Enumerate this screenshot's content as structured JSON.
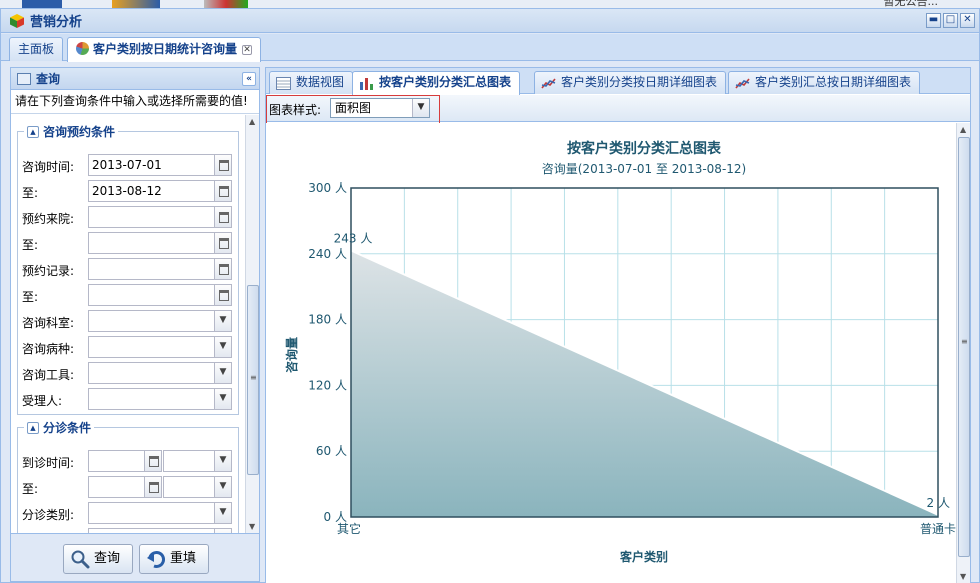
{
  "top_strip": {
    "notice": "暂无公告..."
  },
  "window": {
    "title": "营销分析",
    "min_glyph": "▬",
    "max_glyph": "□",
    "close_glyph": "✕"
  },
  "tabs": [
    {
      "label": "主面板"
    },
    {
      "label": "客户类别按日期统计咨询量",
      "close": "✕"
    }
  ],
  "query_panel": {
    "title": "查询",
    "collapse_glyph": "«",
    "hint": "请在下列查询条件中输入或选择所需要的值!",
    "group1": {
      "legend": "咨询预约条件",
      "rows": [
        {
          "label": "咨询时间:",
          "value": "2013-07-01",
          "kind": "date"
        },
        {
          "label": "至:",
          "value": "2013-08-12",
          "kind": "date"
        },
        {
          "label": "预约来院:",
          "value": "",
          "kind": "date"
        },
        {
          "label": "至:",
          "value": "",
          "kind": "date"
        },
        {
          "label": "预约记录:",
          "value": "",
          "kind": "date"
        },
        {
          "label": "至:",
          "value": "",
          "kind": "date"
        },
        {
          "label": "咨询科室:",
          "value": "",
          "kind": "combo"
        },
        {
          "label": "咨询病种:",
          "value": "",
          "kind": "combo"
        },
        {
          "label": "咨询工具:",
          "value": "",
          "kind": "combo"
        },
        {
          "label": "受理人:",
          "value": "",
          "kind": "combo"
        }
      ]
    },
    "group2": {
      "legend": "分诊条件",
      "rows": [
        {
          "label": "到诊时间:",
          "kind": "datecombo"
        },
        {
          "label": "至:",
          "kind": "datecombo"
        },
        {
          "label": "分诊类别:",
          "kind": "combo"
        },
        {
          "label": "",
          "kind": "combo"
        }
      ]
    },
    "query_button": "查询",
    "reset_button": "重填"
  },
  "right_tabs": [
    {
      "label": "数据视图",
      "icon": "grid-icon"
    },
    {
      "label": "按客户类别分类汇总图表",
      "icon": "bar-chart-icon",
      "active": true
    },
    {
      "label": "客户类别分类按日期详细图表",
      "icon": "line-chart-icon"
    },
    {
      "label": "客户类别汇总按日期详细图表",
      "icon": "line-chart-icon"
    }
  ],
  "toolbar": {
    "style_label": "图表样式:",
    "style_value": "面积图"
  },
  "chart_data": {
    "type": "area",
    "title": "按客户类别分类汇总图表",
    "subtitle": "咨询量(2013-07-01 至 2013-08-12)",
    "xlabel": "客户类别",
    "ylabel": "咨询量",
    "categories": [
      "其它",
      "普通卡"
    ],
    "values": [
      243,
      2
    ],
    "data_labels": [
      "243 人",
      "2 人"
    ],
    "ylim": [
      0,
      300
    ],
    "yticks": [
      0,
      60,
      120,
      180,
      240,
      300
    ],
    "ytick_labels": [
      "0 人",
      "60 人",
      "120 人",
      "180 人",
      "240 人",
      "300 人"
    ],
    "grid": true,
    "colors": {
      "fill_top": "#dde3e6",
      "fill_bottom": "#8ab4bd",
      "line": "#ffffff",
      "grid": "#b8e0e8",
      "axis": "#2f4f5f",
      "text": "#1f5870"
    }
  }
}
